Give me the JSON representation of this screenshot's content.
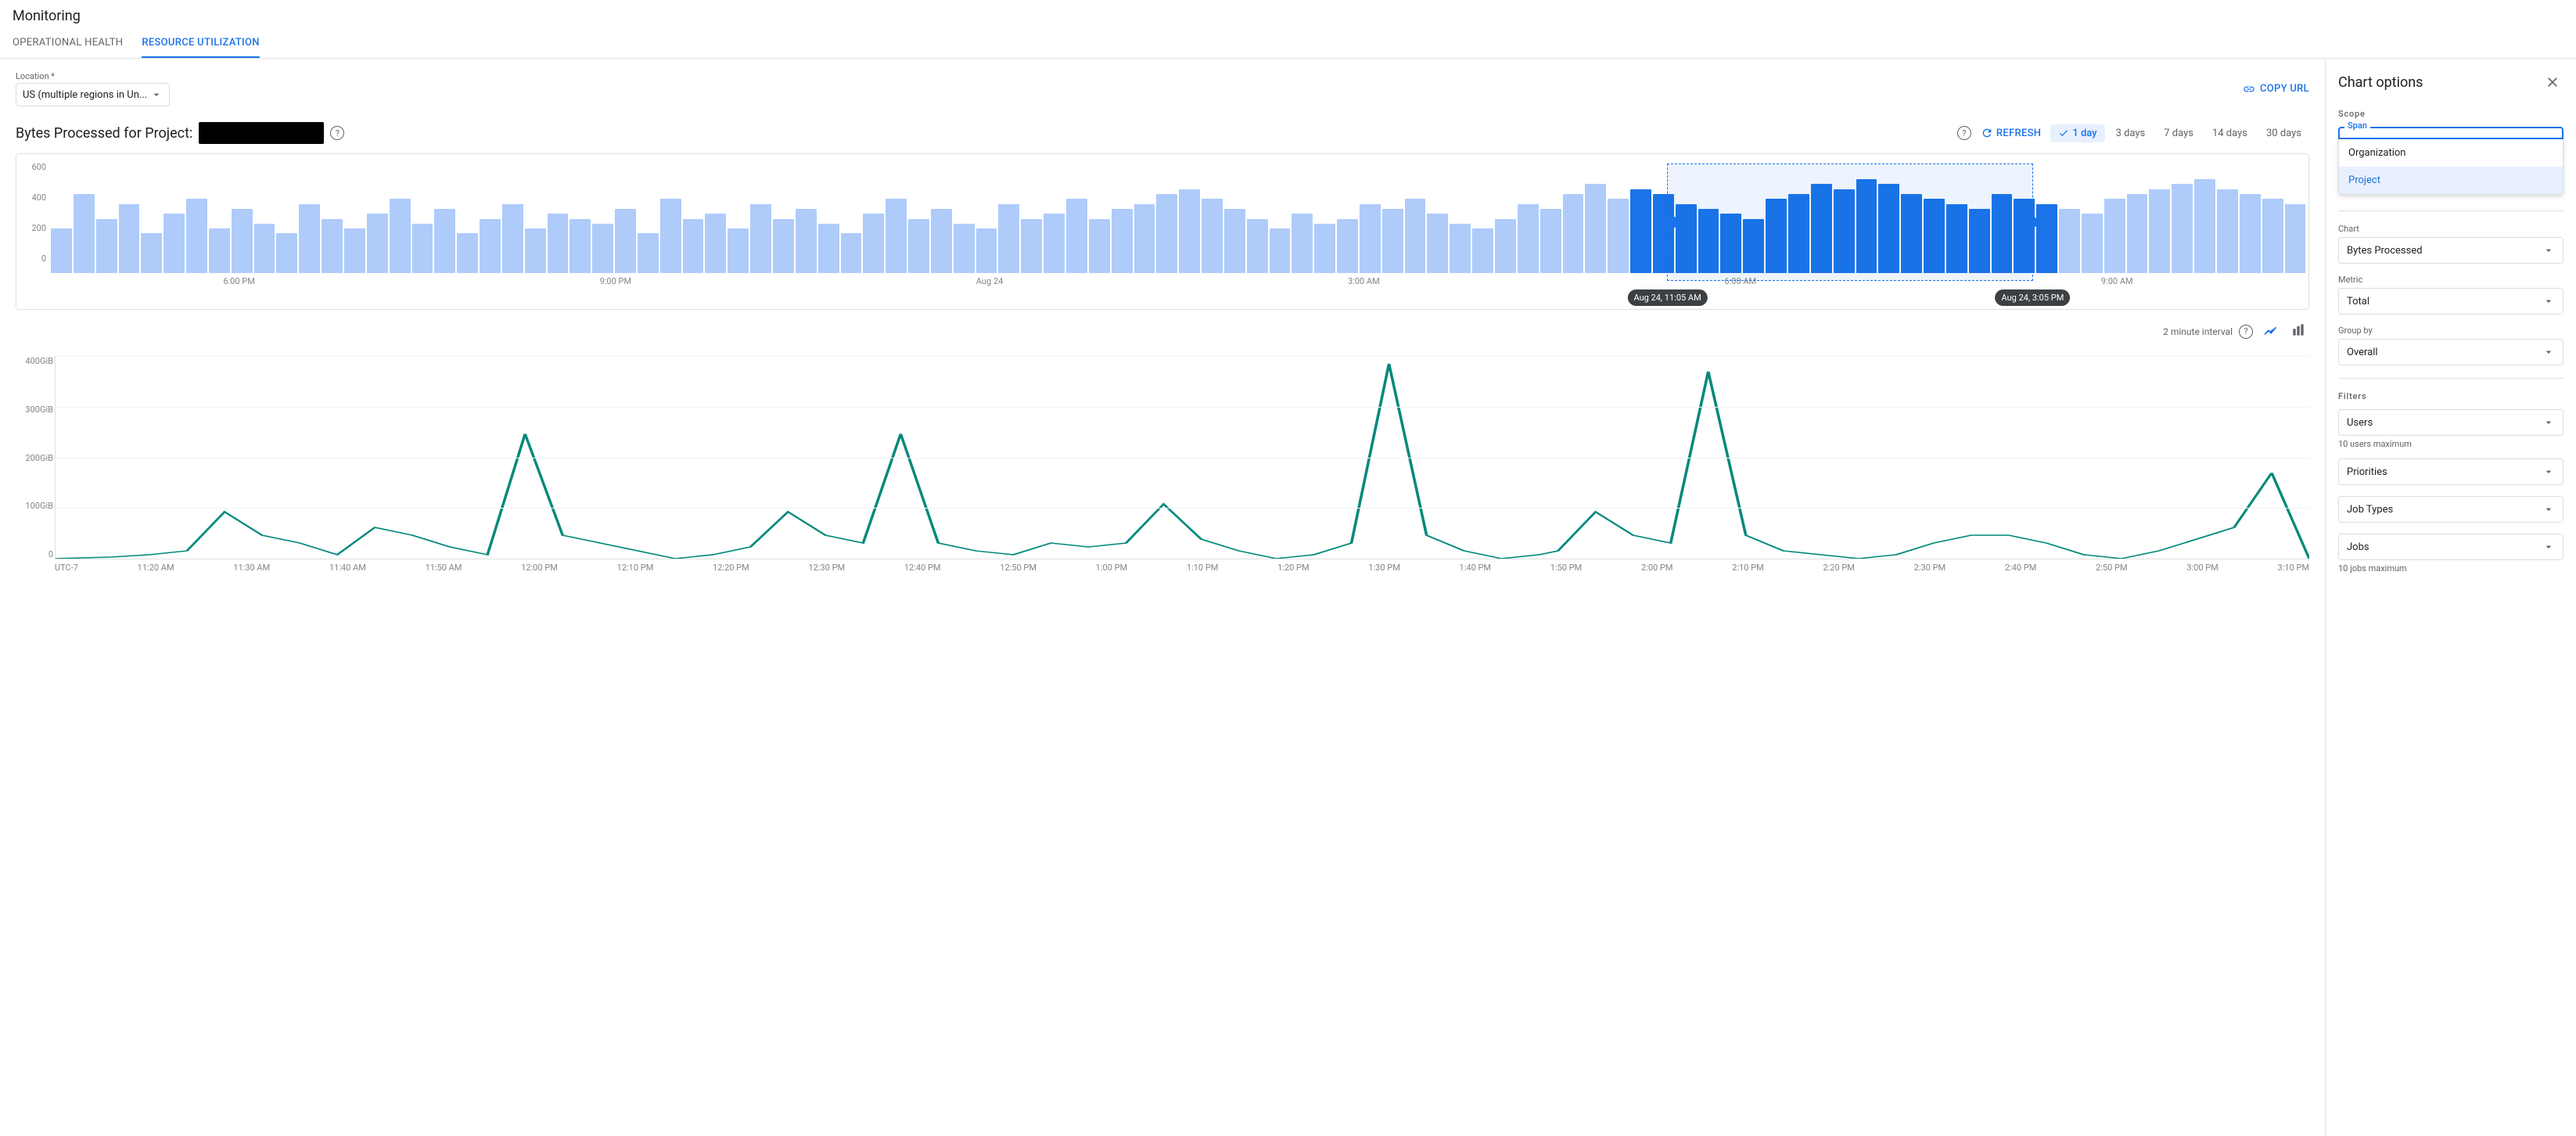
{
  "app": {
    "title": "Monitoring"
  },
  "tabs": [
    {
      "id": "operational-health",
      "label": "OPERATIONAL HEALTH",
      "active": false
    },
    {
      "id": "resource-utilization",
      "label": "RESOURCE UTILIZATION",
      "active": true
    }
  ],
  "location": {
    "label": "Location *",
    "value": "US (multiple regions in Un..."
  },
  "copy_url_label": "COPY URL",
  "chart_title": "Bytes Processed for Project:",
  "help_icon_label": "?",
  "controls": {
    "refresh_label": "REFRESH",
    "time_options": [
      {
        "label": "1 day",
        "active": true
      },
      {
        "label": "3 days",
        "active": false
      },
      {
        "label": "7 days",
        "active": false
      },
      {
        "label": "14 days",
        "active": false
      },
      {
        "label": "30 days",
        "active": false
      }
    ]
  },
  "overview_chart": {
    "y_labels": [
      "600",
      "400",
      "200",
      "0"
    ],
    "x_labels": [
      "6:00 PM",
      "9:00 PM",
      "Aug 24",
      "3:00 AM",
      "6:00 AM",
      "9:00 AM"
    ],
    "range_start_label": "Aug 24, 11:05 AM",
    "range_end_label": "Aug 24, 3:05 PM",
    "bars": [
      45,
      80,
      55,
      70,
      40,
      60,
      75,
      45,
      65,
      50,
      40,
      70,
      55,
      45,
      60,
      75,
      50,
      65,
      40,
      55,
      70,
      45,
      60,
      55,
      50,
      65,
      40,
      75,
      55,
      60,
      45,
      70,
      55,
      65,
      50,
      40,
      60,
      75,
      55,
      65,
      50,
      45,
      70,
      55,
      60,
      75,
      55,
      65,
      70,
      80,
      85,
      75,
      65,
      55,
      45,
      60,
      50,
      55,
      70,
      65,
      75,
      60,
      50,
      45,
      55,
      70,
      65,
      80,
      90,
      75,
      85,
      80,
      70,
      65,
      60,
      55,
      75,
      80,
      90,
      85,
      95,
      90,
      80,
      75,
      70,
      65,
      80,
      75,
      70,
      65,
      60,
      75,
      80,
      85,
      90,
      95,
      85,
      80,
      75,
      70
    ]
  },
  "interval_label": "2 minute interval",
  "detail_chart": {
    "y_labels": [
      "400GiB",
      "300GiB",
      "200GiB",
      "100GiB",
      "0"
    ],
    "x_labels": [
      "UTC-7",
      "11:20 AM",
      "11:30 AM",
      "11:40 AM",
      "11:50 AM",
      "12:00 PM",
      "12:10 PM",
      "12:20 PM",
      "12:30 PM",
      "12:40 PM",
      "12:50 PM",
      "1:00 PM",
      "1:10 PM",
      "1:20 PM",
      "1:30 PM",
      "1:40 PM",
      "1:50 PM",
      "2:00 PM",
      "2:10 PM",
      "2:20 PM",
      "2:30 PM",
      "2:40 PM",
      "2:50 PM",
      "3:00 PM",
      "3:10 PM"
    ]
  },
  "sidebar": {
    "title": "Chart options",
    "scope_section_label": "Scope",
    "span_label": "Span",
    "span_options": [
      {
        "label": "Organization",
        "selected": false
      },
      {
        "label": "Project",
        "selected": true
      }
    ],
    "chart_section_label": "Chart",
    "chart_value": "Bytes Processed",
    "metric_section_label": "Metric",
    "metric_value": "Total",
    "group_by_section_label": "Group by",
    "group_by_value": "Overall",
    "filters_section_label": "Filters",
    "filter_users_label": "Users",
    "filter_users_hint": "10 users maximum",
    "filter_priorities_label": "Priorities",
    "filter_job_types_label": "Job Types",
    "filter_jobs_label": "Jobs",
    "filter_jobs_hint": "10 jobs maximum"
  }
}
